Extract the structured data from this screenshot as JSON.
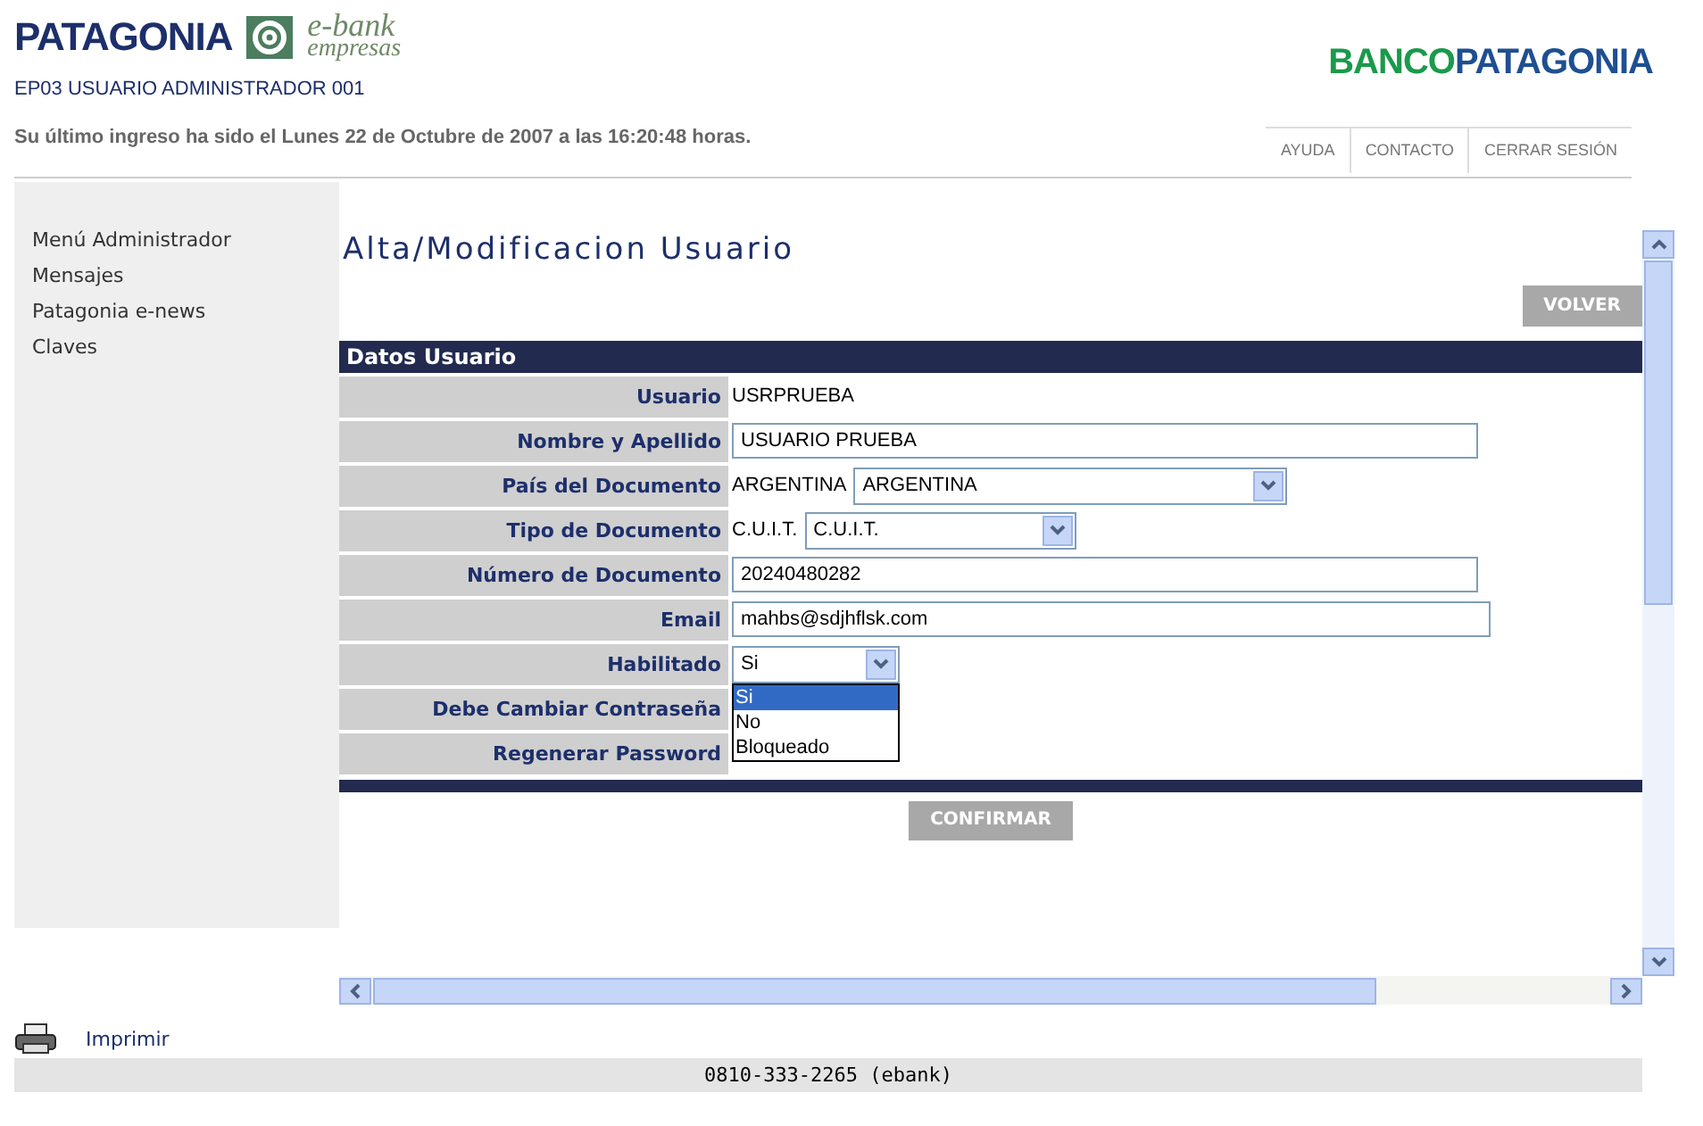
{
  "header": {
    "logo_text": "PATAGONIA",
    "ebank_line1": "e-bank",
    "ebank_line2": "empresas",
    "bank_logo": [
      "BANCO",
      "PATAGONIA"
    ],
    "user": "EP03 USUARIO ADMINISTRADOR 001",
    "last_login": "Su último ingreso ha sido el Lunes 22 de Octubre de 2007 a las 16:20:48 horas.",
    "links": [
      "AYUDA",
      "CONTACTO",
      "CERRAR SESIÓN"
    ]
  },
  "sidebar": {
    "items": [
      "Menú Administrador",
      "Mensajes",
      "Patagonia e-news",
      "Claves"
    ]
  },
  "page": {
    "title": "Alta/Modificacion Usuario",
    "back_button": "VOLVER",
    "section": "Datos Usuario",
    "fields": [
      {
        "label": "Usuario",
        "kind": "text",
        "value": "USRPRUEBA"
      },
      {
        "label": "Nombre y Apellido",
        "kind": "input",
        "value": "USUARIO PRUEBA"
      },
      {
        "label": "País del Documento",
        "kind": "text_select",
        "value": "ARGENTINA",
        "select": "ARGENTINA"
      },
      {
        "label": "Tipo de Documento",
        "kind": "text_select",
        "value": "C.U.I.T.",
        "select": "C.U.I.T."
      },
      {
        "label": "Número de Documento",
        "kind": "input",
        "value": "20240480282"
      },
      {
        "label": "Email",
        "kind": "input",
        "value": "mahbs@sdjhflsk.com"
      },
      {
        "label": "Habilitado",
        "kind": "open_select",
        "select": "Si",
        "options": [
          {
            "label": "Si",
            "selected": true
          },
          {
            "label": "No",
            "selected": false
          },
          {
            "label": "Bloqueado",
            "selected": false
          }
        ]
      },
      {
        "label": "Debe Cambiar Contraseña",
        "kind": "empty"
      },
      {
        "label": "Regenerar Password",
        "kind": "empty"
      }
    ],
    "confirm_button": "CONFIRMAR"
  },
  "footer": {
    "print": "Imprimir",
    "phone": "0810-333-2265 (ebank)"
  }
}
